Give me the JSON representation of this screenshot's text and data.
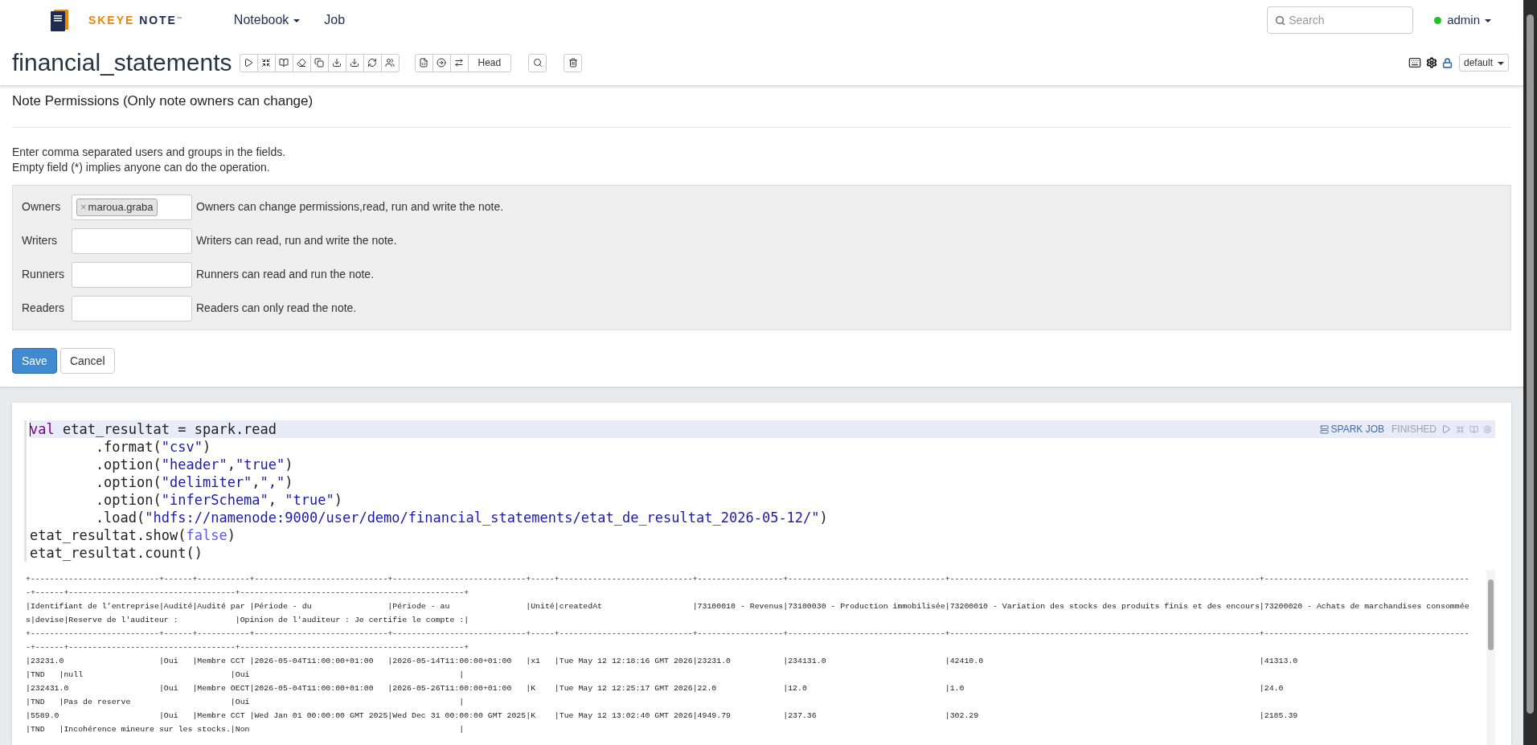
{
  "navbar": {
    "brand": {
      "part_1": "SKEYE",
      "part_2": "NOTE",
      "mark": "™"
    },
    "menu": [
      {
        "label": "Notebook",
        "dropdown": true
      },
      {
        "label": "Job",
        "dropdown": false
      }
    ],
    "search": {
      "placeholder": "Search"
    },
    "user": {
      "name": "admin",
      "online": true
    }
  },
  "note": {
    "title": "financial_statements",
    "head_label": "Head",
    "binding": "default"
  },
  "permissions": {
    "title": "Note Permissions (Only note owners can change)",
    "hint_lines": [
      "Enter comma separated users and groups in the fields.",
      "Empty field (*) implies anyone can do the operation."
    ],
    "fields": [
      {
        "label": "Owners",
        "tags": [
          {
            "label": "maroua.graba",
            "remove": "×"
          }
        ],
        "description": "Owners can change permissions,read, run and write the note."
      },
      {
        "label": "Writers",
        "description": "Writers can read, run and write the note."
      },
      {
        "label": "Runners",
        "description": "Runners can read and run the note."
      },
      {
        "label": "Readers",
        "description": "Readers can only read the note."
      }
    ],
    "buttons": [
      {
        "label": "Save",
        "kind": "primary"
      },
      {
        "label": "Cancel",
        "kind": "default"
      }
    ]
  },
  "paragraph": {
    "job_label": "SPARK JOB",
    "status": "FINISHED",
    "code_lines": [
      {
        "active": true,
        "tokens": [
          {
            "kind": "keyword",
            "text": "val"
          },
          {
            "kind": "plain",
            "text": " etat_resultat = spark.read"
          }
        ]
      },
      {
        "active": false,
        "tokens": [
          {
            "kind": "plain",
            "text": "        .format("
          },
          {
            "kind": "string",
            "text": "\"csv\""
          },
          {
            "kind": "plain",
            "text": ")"
          }
        ]
      },
      {
        "active": false,
        "tokens": [
          {
            "kind": "plain",
            "text": "        .option("
          },
          {
            "kind": "string",
            "text": "\"header\""
          },
          {
            "kind": "plain",
            "text": ","
          },
          {
            "kind": "string",
            "text": "\"true\""
          },
          {
            "kind": "plain",
            "text": ")"
          }
        ]
      },
      {
        "active": false,
        "tokens": [
          {
            "kind": "plain",
            "text": "        .option("
          },
          {
            "kind": "string",
            "text": "\"delimiter\""
          },
          {
            "kind": "plain",
            "text": ","
          },
          {
            "kind": "string",
            "text": "\",\""
          },
          {
            "kind": "plain",
            "text": ")"
          }
        ]
      },
      {
        "active": false,
        "tokens": [
          {
            "kind": "plain",
            "text": "        .option("
          },
          {
            "kind": "string",
            "text": "\"inferSchema\""
          },
          {
            "kind": "plain",
            "text": ", "
          },
          {
            "kind": "string",
            "text": "\"true\""
          },
          {
            "kind": "plain",
            "text": ")"
          }
        ]
      },
      {
        "active": false,
        "tokens": [
          {
            "kind": "plain",
            "text": "        .load("
          },
          {
            "kind": "string",
            "text": "\"hdfs://namenode:9000/user/demo/financial_statements/etat_de_resultat_2026-05-12/\""
          },
          {
            "kind": "plain",
            "text": ")"
          }
        ]
      },
      {
        "active": false,
        "tokens": [
          {
            "kind": "plain",
            "text": "etat_resultat.show("
          },
          {
            "kind": "atom",
            "text": "false"
          },
          {
            "kind": "plain",
            "text": ")"
          }
        ]
      },
      {
        "active": false,
        "tokens": [
          {
            "kind": "plain",
            "text": "etat_resultat.count()"
          }
        ]
      }
    ],
    "output_lines": [
      "+---------------------------+------+-----------+----------------------------+----------------------------+-----+----------------------------+------------------+---------------------------------+-----------------------------------------------------------------+--------------------------------------------+------+-----------------------------------+-----------------------------------------------+",
      "|Identifiant de l’entreprise|Audité|Audité par |Période - du                |Période - au                |Unité|createdAt                   |73100010 - Revenus|73100030 - Production immobilisée|73200010 - Variation des stocks des produits finis et des encours|73200020 - Achats de marchandises consommées|devise|Reserve de l'auditeur :            |Opinion de l'auditeur : Je certifie le compte :|",
      "+---------------------------+------+-----------+----------------------------+----------------------------+-----+----------------------------+------------------+---------------------------------+-----------------------------------------------------------------+--------------------------------------------+------+-----------------------------------+-----------------------------------------------+",
      "|23231.0                    |Oui   |Membre CCT |2026-05-04T11:00:00+01:00   |2026-05-14T11:00:00+01:00   |x1   |Tue May 12 12:18:16 GMT 2026|23231.0           |234131.0                         |42410.0                                                          |41313.0                                     |TND   |null                               |Oui                                            |",
      "|232431.0                   |Oui   |Membre OECT|2026-05-04T11:00:00+01:00   |2026-05-26T11:00:00+01:00   |K    |Tue May 12 12:25:17 GMT 2026|22.0              |12.0                             |1.0                                                              |24.0                                        |TND   |Pas de reserve                     |Oui                                            |",
      "|5589.0                     |Oui   |Membre CCT |Wed Jan 01 00:00:00 GMT 2025|Wed Dec 31 00:00:00 GMT 2025|K    |Tue May 12 13:02:40 GMT 2026|4949.79           |237.36                           |302.29                                                           |2185.39                                     |TND   |Incohérence mineure sur les stocks.|Non                                            |"
    ]
  }
}
